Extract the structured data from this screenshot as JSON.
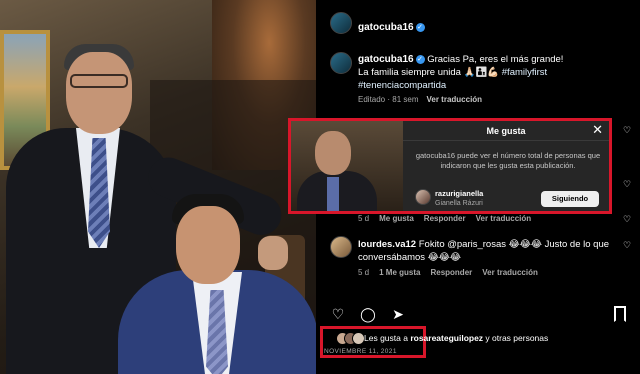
{
  "post": {
    "username": "gatocuba16",
    "caption_line1": "Gracias Pa, eres el más grande!",
    "caption_line2": "La familia siempre unida",
    "caption_emojis": "🙏🏻👨‍👦💪🏻",
    "hashtag1": "#familyfirst",
    "hashtag2": "#tenenciacompartida",
    "edited": "Editado · 81 sem",
    "translate": "Ver traducción"
  },
  "likes_modal": {
    "title": "Me gusta",
    "close_glyph": "✕",
    "message": "gatocuba16 puede ver el número total de personas que indicaron que les gusta esta publicación.",
    "user": {
      "username": "razurigianella",
      "full_name": "Gianella Rázuri",
      "button": "Siguiendo"
    }
  },
  "comment1_meta": {
    "time": "5 d",
    "likes": "Me gusta",
    "reply": "Responder",
    "translate": "Ver traducción"
  },
  "comment2": {
    "username": "lourdes.va12",
    "text": "Fokito @paris_rosas 😂😂😂 Justo de lo que conversábamos 😂😂😂",
    "time": "5 d",
    "likes": "1 Me gusta",
    "reply": "Responder",
    "translate": "Ver traducción"
  },
  "actions": {
    "like_icon": "heart-outline",
    "comment_icon": "comment-bubble",
    "share_icon": "paper-plane",
    "save_icon": "bookmark"
  },
  "likes": {
    "prefix": "Les gusta a ",
    "user": "rosareateguilopez",
    "suffix": " y otras personas"
  },
  "date": "NOVIEMBRE 11, 2021",
  "colors": {
    "highlight": "#d8162a",
    "verified": "#3897f0",
    "modal_bg": "#262626"
  }
}
